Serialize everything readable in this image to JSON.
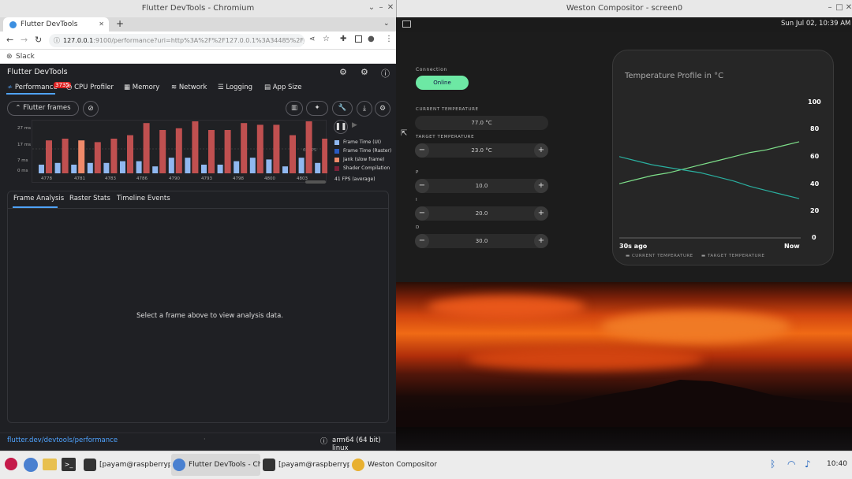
{
  "chromium": {
    "window_title": "Flutter DevTools - Chromium",
    "tab_title": "Flutter DevTools",
    "url": "127.0.0.1:9100/performance?uri=http%3A%2F%2F127.0.0.1%3A34485%2FJO0_Ktc6V...",
    "url_host": "127.0.0.1",
    "url_rest": ":9100/performance?uri=http%3A%2F%2F127.0.0.1%3A34485%2FJO0_Ktc6V...",
    "bookmark": "Slack"
  },
  "devtools": {
    "title": "Flutter DevTools",
    "tabs": [
      {
        "label": "Performance",
        "badge": "3735"
      },
      {
        "label": "CPU Profiler"
      },
      {
        "label": "Memory"
      },
      {
        "label": "Network"
      },
      {
        "label": "Logging"
      },
      {
        "label": "App Size"
      }
    ],
    "flutter_frames_label": "Flutter frames",
    "legend": [
      "Frame Time (UI)",
      "Frame Time (Raster)",
      "Jank (slow frame)",
      "Shader Compilation"
    ],
    "fps_label": "41 FPS (average)",
    "fps_marker": "60 FPS",
    "panel_tabs": [
      "Frame Analysis",
      "Raster Stats",
      "Timeline Events"
    ],
    "empty_message": "Select a frame above to view analysis data.",
    "footer_link": "flutter.dev/devtools/performance",
    "footer_platform": "arm64 (64 bit) linux",
    "colors": {
      "ui": "#90b8f0",
      "raster": "#c05050",
      "jank": "#f08a6a",
      "shader": "#7a2038"
    }
  },
  "chart_data": {
    "type": "bar",
    "title": "",
    "ylabel": "",
    "y_ticks": [
      "27 ms",
      "17 ms",
      "7 ms",
      "0 ms"
    ],
    "x_ticks": [
      "4778",
      "4781",
      "4783",
      "4786",
      "4790",
      "4793",
      "4798",
      "4800",
      "4803"
    ],
    "series": [
      {
        "name": "Frame Time (UI)",
        "values": [
          5,
          6,
          5,
          6,
          6,
          7,
          7,
          4,
          9,
          9,
          5,
          5,
          7,
          9,
          8,
          4,
          9,
          6
        ]
      },
      {
        "name": "Frame Time (Raster)",
        "values": [
          19,
          20,
          19,
          18,
          20,
          22,
          29,
          25,
          26,
          30,
          25,
          25,
          29,
          28,
          28,
          22,
          30,
          20
        ]
      }
    ],
    "jank_frames": [
      2
    ],
    "ylim": [
      0,
      30
    ]
  },
  "weston": {
    "window_title": "Weston Compositor - screen0",
    "clock": "Sun Jul 02, 10:39 AM"
  },
  "thermo_app": {
    "connection_label": "Connection",
    "connection_status": "Online",
    "current_temp_label": "CURRENT TEMPERATURE",
    "current_temp_value": "77.0 °C",
    "target_temp_label": "TARGET TEMPERATURE",
    "target_temp_value": "23.0 °C",
    "p_label": "P",
    "p_value": "10.0",
    "i_label": "I",
    "i_value": "20.0",
    "d_label": "D",
    "d_value": "30.0",
    "profile_title": "Temperature Profile in °C",
    "y_axis_ticks": [
      "100",
      "80",
      "60",
      "40",
      "20",
      "0"
    ],
    "x_start": "30s ago",
    "x_end": "Now",
    "legend_current": "CURRENT TEMPERATURE",
    "legend_target": "TARGET TEMPERATURE",
    "colors": {
      "current": "#7ee08a",
      "target": "#2ab0a0",
      "online_chip": "#6de8a4"
    }
  },
  "profile_chart": {
    "type": "line",
    "ylim": [
      0,
      100
    ],
    "series": [
      {
        "name": "CURRENT TEMPERATURE",
        "values": [
          40,
          43,
          46,
          48,
          51,
          54,
          57,
          60,
          63,
          65,
          68,
          71
        ]
      },
      {
        "name": "TARGET TEMPERATURE",
        "values": [
          60,
          57,
          54,
          52,
          50,
          48,
          45,
          42,
          38,
          35,
          32,
          29
        ]
      }
    ]
  },
  "taskbar": {
    "items": [
      "[payam@raspberrypi...",
      "Flutter DevTools - Ch...",
      "[payam@raspberrypi...",
      "Weston Compositor -..."
    ],
    "time": "10:40"
  }
}
